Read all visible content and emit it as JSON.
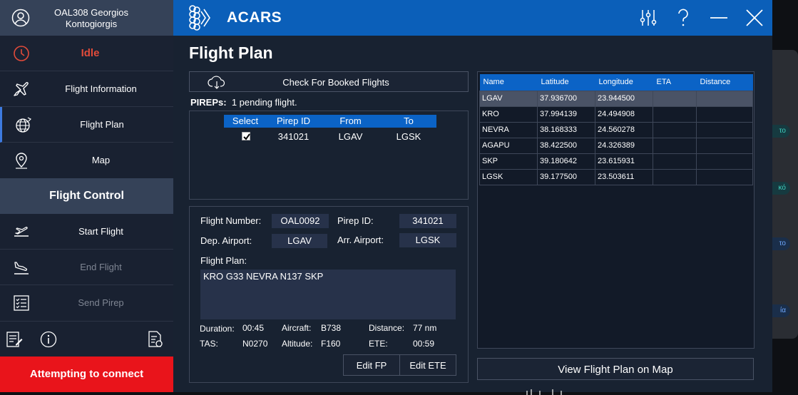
{
  "app": {
    "name": "ACARS"
  },
  "user": {
    "name": "OAL308 Georgios Kontogiorgis"
  },
  "status": {
    "label": "Idle"
  },
  "sidebar": {
    "items": [
      {
        "label": "Flight Information",
        "icon": "airplane-icon"
      },
      {
        "label": "Flight Plan",
        "icon": "globe-icon"
      },
      {
        "label": "Map",
        "icon": "map-pin-icon"
      }
    ],
    "control_heading": "Flight Control",
    "control_items": [
      {
        "label": "Start Flight",
        "icon": "takeoff-icon",
        "enabled": true
      },
      {
        "label": "End Flight",
        "icon": "landing-icon",
        "enabled": false
      },
      {
        "label": "Send Pirep",
        "icon": "checklist-icon",
        "enabled": false
      }
    ],
    "tools": [
      "notes-icon",
      "info-icon",
      "report-icon"
    ],
    "connection_status": "Attempting to connect"
  },
  "page": {
    "title": "Flight Plan"
  },
  "booked": {
    "check_button": "Check For Booked Flights",
    "pireps_label": "PIREPs:",
    "pireps_text": "1 pending flight.",
    "columns": [
      "Select",
      "Pirep ID",
      "From",
      "To"
    ],
    "rows": [
      {
        "selected": true,
        "pirep_id": "341021",
        "from": "LGAV",
        "to": "LGSK"
      }
    ]
  },
  "details": {
    "flight_number_label": "Flight Number:",
    "flight_number": "OAL0092",
    "pirep_id_label": "Pirep ID:",
    "pirep_id": "341021",
    "dep_label": "Dep. Airport:",
    "dep": "LGAV",
    "arr_label": "Arr. Airport:",
    "arr": "LGSK",
    "plan_label": "Flight Plan:",
    "plan": "KRO G33 NEVRA N137 SKP",
    "duration_label": "Duration:",
    "duration": "00:45",
    "aircraft_label": "Aircraft:",
    "aircraft": "B738",
    "distance_label": "Distance:",
    "distance": "77 nm",
    "tas_label": "TAS:",
    "tas": "N0270",
    "altitude_label": "Altitude:",
    "altitude": "F160",
    "ete_label": "ETE:",
    "ete": "00:59",
    "edit_fp": "Edit FP",
    "edit_ete": "Edit ETE"
  },
  "waypoints": {
    "columns": [
      "Name",
      "Latitude",
      "Longitude",
      "ETA",
      "Distance"
    ],
    "rows": [
      {
        "name": "LGAV",
        "lat": "37.936700",
        "lon": "23.944500",
        "eta": "",
        "dist": ""
      },
      {
        "name": "KRO",
        "lat": "37.994139",
        "lon": "24.494908",
        "eta": "",
        "dist": ""
      },
      {
        "name": "NEVRA",
        "lat": "38.168333",
        "lon": "24.560278",
        "eta": "",
        "dist": ""
      },
      {
        "name": "AGAPU",
        "lat": "38.422500",
        "lon": "24.326389",
        "eta": "",
        "dist": ""
      },
      {
        "name": "SKP",
        "lat": "39.180642",
        "lon": "23.615931",
        "eta": "",
        "dist": ""
      },
      {
        "name": "LGSK",
        "lat": "39.177500",
        "lon": "23.503611",
        "eta": "",
        "dist": ""
      }
    ],
    "selected_index": 0,
    "view_map_button": "View Flight Plan on Map"
  },
  "background_app": {
    "pills": [
      "το",
      "κό",
      "το",
      "ία"
    ]
  },
  "colors": {
    "accent": "#0b5fb9",
    "header_blue": "#0b63c6",
    "status_red": "#e24b3a",
    "connect_red": "#e9141b"
  }
}
